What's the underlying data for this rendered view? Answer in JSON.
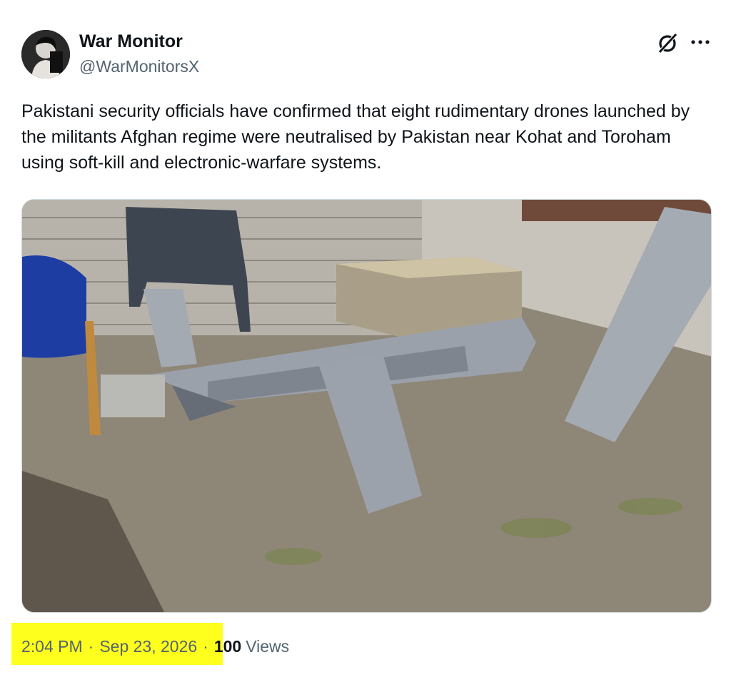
{
  "author": {
    "display_name": "War Monitor",
    "handle": "@WarMonitorsX"
  },
  "icons": {
    "grok": "grok-icon",
    "more": "more-horizontal-icon"
  },
  "tweet": {
    "text": "Pakistani security officials have confirmed that eight rudimentary drones launched by the militants Afghan regime were neutralised by Pakistan near Kohat and Toroham using soft-kill and electronic-warfare systems."
  },
  "meta": {
    "time": "2:04 PM",
    "separator": "·",
    "date": "Sep 23, 2026",
    "views_count": "100",
    "views_label": "Views"
  },
  "colors": {
    "text_primary": "#0f1419",
    "text_secondary": "#536471",
    "highlight": "#ffff1e"
  }
}
